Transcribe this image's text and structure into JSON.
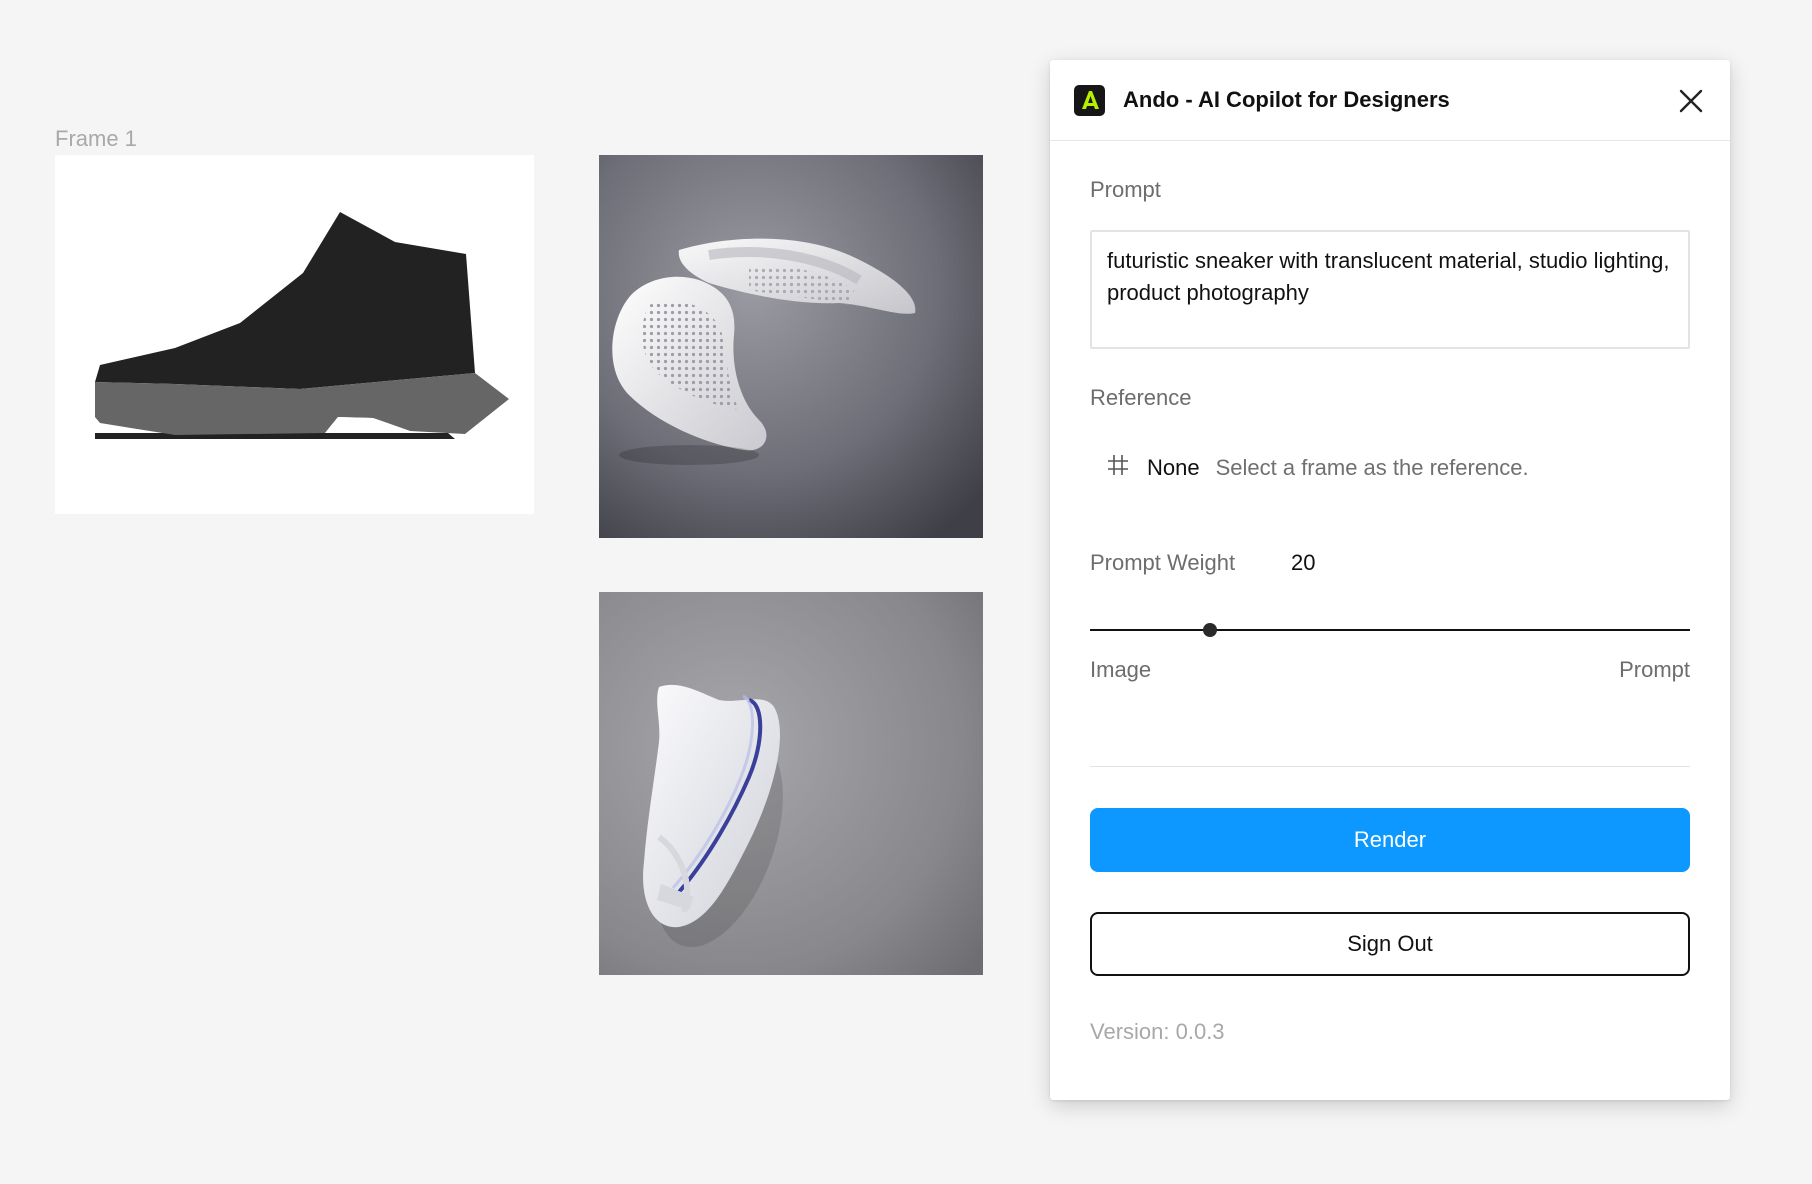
{
  "canvas": {
    "frame_label": "Frame 1"
  },
  "plugin": {
    "title": "Ando - AI Copilot for Designers",
    "brand_color": "#b6f000",
    "prompt": {
      "label": "Prompt",
      "value": "futuristic sneaker with translucent material, studio lighting, product photography"
    },
    "reference": {
      "label": "Reference",
      "icon": "frame-hash-icon",
      "value": "None",
      "hint": "Select a frame as the reference."
    },
    "prompt_weight": {
      "label": "Prompt Weight",
      "value": "20",
      "slider_fraction": 0.2,
      "min_label": "Image",
      "max_label": "Prompt"
    },
    "render_button": {
      "label": "Render",
      "color": "#0c98ff"
    },
    "signout_button": {
      "label": "Sign Out"
    },
    "version": "Version: 0.0.3"
  }
}
